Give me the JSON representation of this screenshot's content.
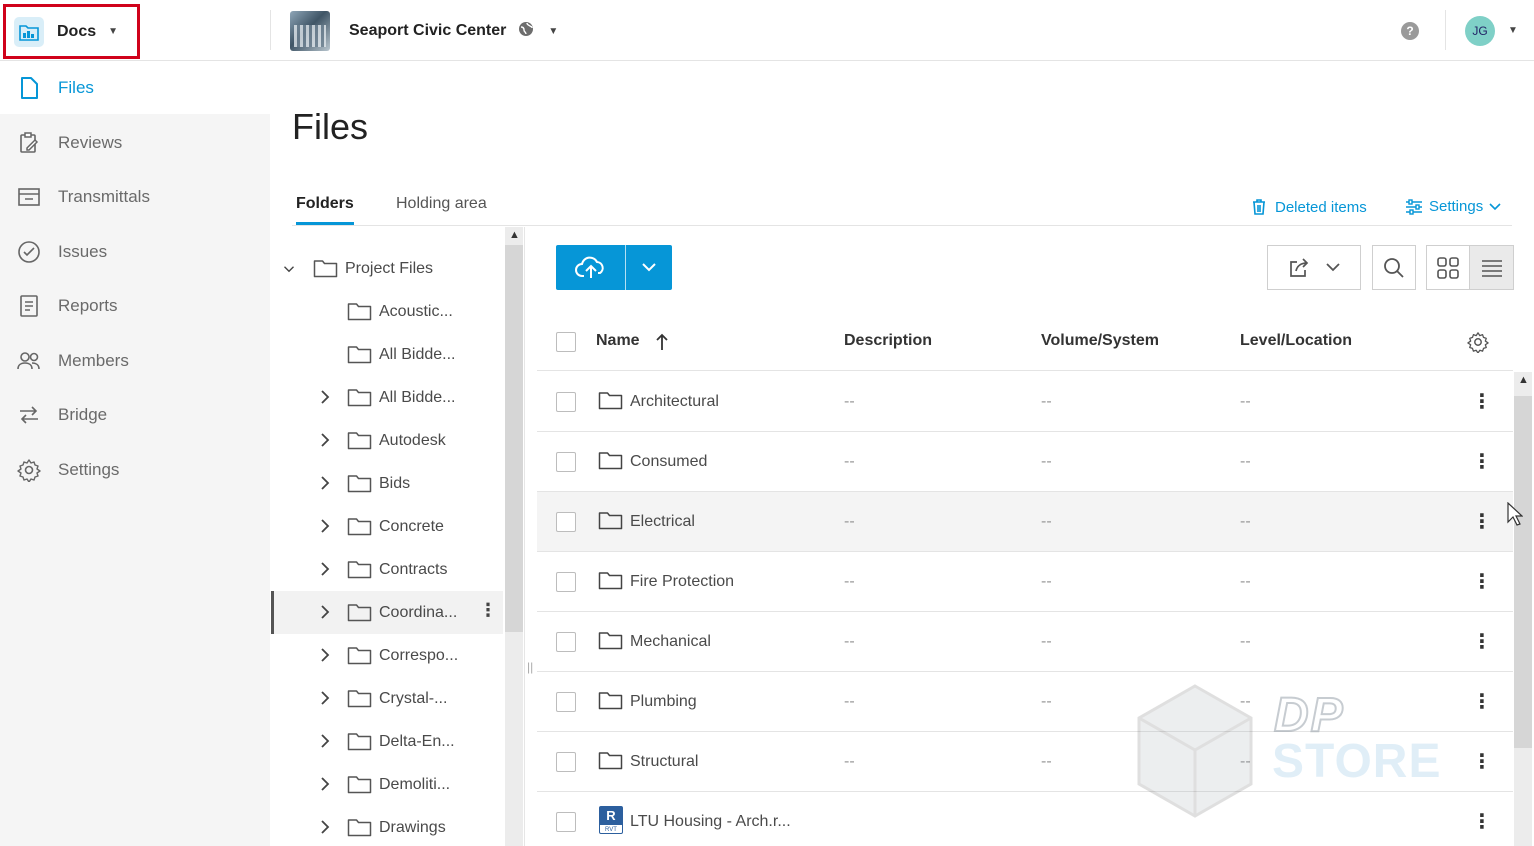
{
  "header": {
    "module_label": "Docs",
    "project_name": "Seaport Civic Center",
    "help_label": "?",
    "user_initials": "JG"
  },
  "sidebar": {
    "items": [
      {
        "label": "Files",
        "icon": "file-icon",
        "active": true
      },
      {
        "label": "Reviews",
        "icon": "reviews-icon",
        "active": false
      },
      {
        "label": "Transmittals",
        "icon": "transmittals-icon",
        "active": false
      },
      {
        "label": "Issues",
        "icon": "issues-icon",
        "active": false
      },
      {
        "label": "Reports",
        "icon": "reports-icon",
        "active": false
      },
      {
        "label": "Members",
        "icon": "members-icon",
        "active": false
      },
      {
        "label": "Bridge",
        "icon": "bridge-icon",
        "active": false
      },
      {
        "label": "Settings",
        "icon": "settings-icon",
        "active": false
      }
    ]
  },
  "main": {
    "title": "Files",
    "tabs": [
      {
        "label": "Folders",
        "active": true
      },
      {
        "label": "Holding area",
        "active": false
      }
    ],
    "deleted_items_label": "Deleted items",
    "settings_label": "Settings"
  },
  "tree": {
    "items": [
      {
        "label": "Project Files",
        "expanded": true,
        "level": 0
      },
      {
        "label": "Acoustic...",
        "level": 1,
        "has_children": false
      },
      {
        "label": "All Bidde...",
        "level": 1,
        "has_children": false
      },
      {
        "label": "All Bidde...",
        "level": 1,
        "has_children": true
      },
      {
        "label": "Autodesk",
        "level": 1,
        "has_children": true
      },
      {
        "label": "Bids",
        "level": 1,
        "has_children": true
      },
      {
        "label": "Concrete",
        "level": 1,
        "has_children": true
      },
      {
        "label": "Contracts",
        "level": 1,
        "has_children": true
      },
      {
        "label": "Coordina...",
        "level": 1,
        "has_children": true,
        "selected": true
      },
      {
        "label": "Correspo...",
        "level": 1,
        "has_children": true
      },
      {
        "label": "Crystal-...",
        "level": 1,
        "has_children": true
      },
      {
        "label": "Delta-En...",
        "level": 1,
        "has_children": true
      },
      {
        "label": "Demoliti...",
        "level": 1,
        "has_children": true
      },
      {
        "label": "Drawings",
        "level": 1,
        "has_children": true
      }
    ]
  },
  "table": {
    "columns": [
      "Name",
      "Description",
      "Volume/System",
      "Level/Location"
    ],
    "rows": [
      {
        "name": "Architectural",
        "description": "--",
        "volume": "--",
        "level": "--",
        "type": "folder"
      },
      {
        "name": "Consumed",
        "description": "--",
        "volume": "--",
        "level": "--",
        "type": "folder"
      },
      {
        "name": "Electrical",
        "description": "--",
        "volume": "--",
        "level": "--",
        "type": "folder",
        "hover": true
      },
      {
        "name": "Fire Protection",
        "description": "--",
        "volume": "--",
        "level": "--",
        "type": "folder"
      },
      {
        "name": "Mechanical",
        "description": "--",
        "volume": "--",
        "level": "--",
        "type": "folder"
      },
      {
        "name": "Plumbing",
        "description": "--",
        "volume": "--",
        "level": "--",
        "type": "folder"
      },
      {
        "name": "Structural",
        "description": "--",
        "volume": "--",
        "level": "--",
        "type": "folder"
      },
      {
        "name": "LTU Housing - Arch.r...",
        "description": "",
        "volume": "",
        "level": "",
        "type": "rvt"
      }
    ]
  },
  "watermark": {
    "line1": "DP",
    "line2": "STORE"
  },
  "colors": {
    "accent": "#0696d7",
    "highlight_box": "#d0021b",
    "sidebar_bg": "#f5f5f5"
  }
}
